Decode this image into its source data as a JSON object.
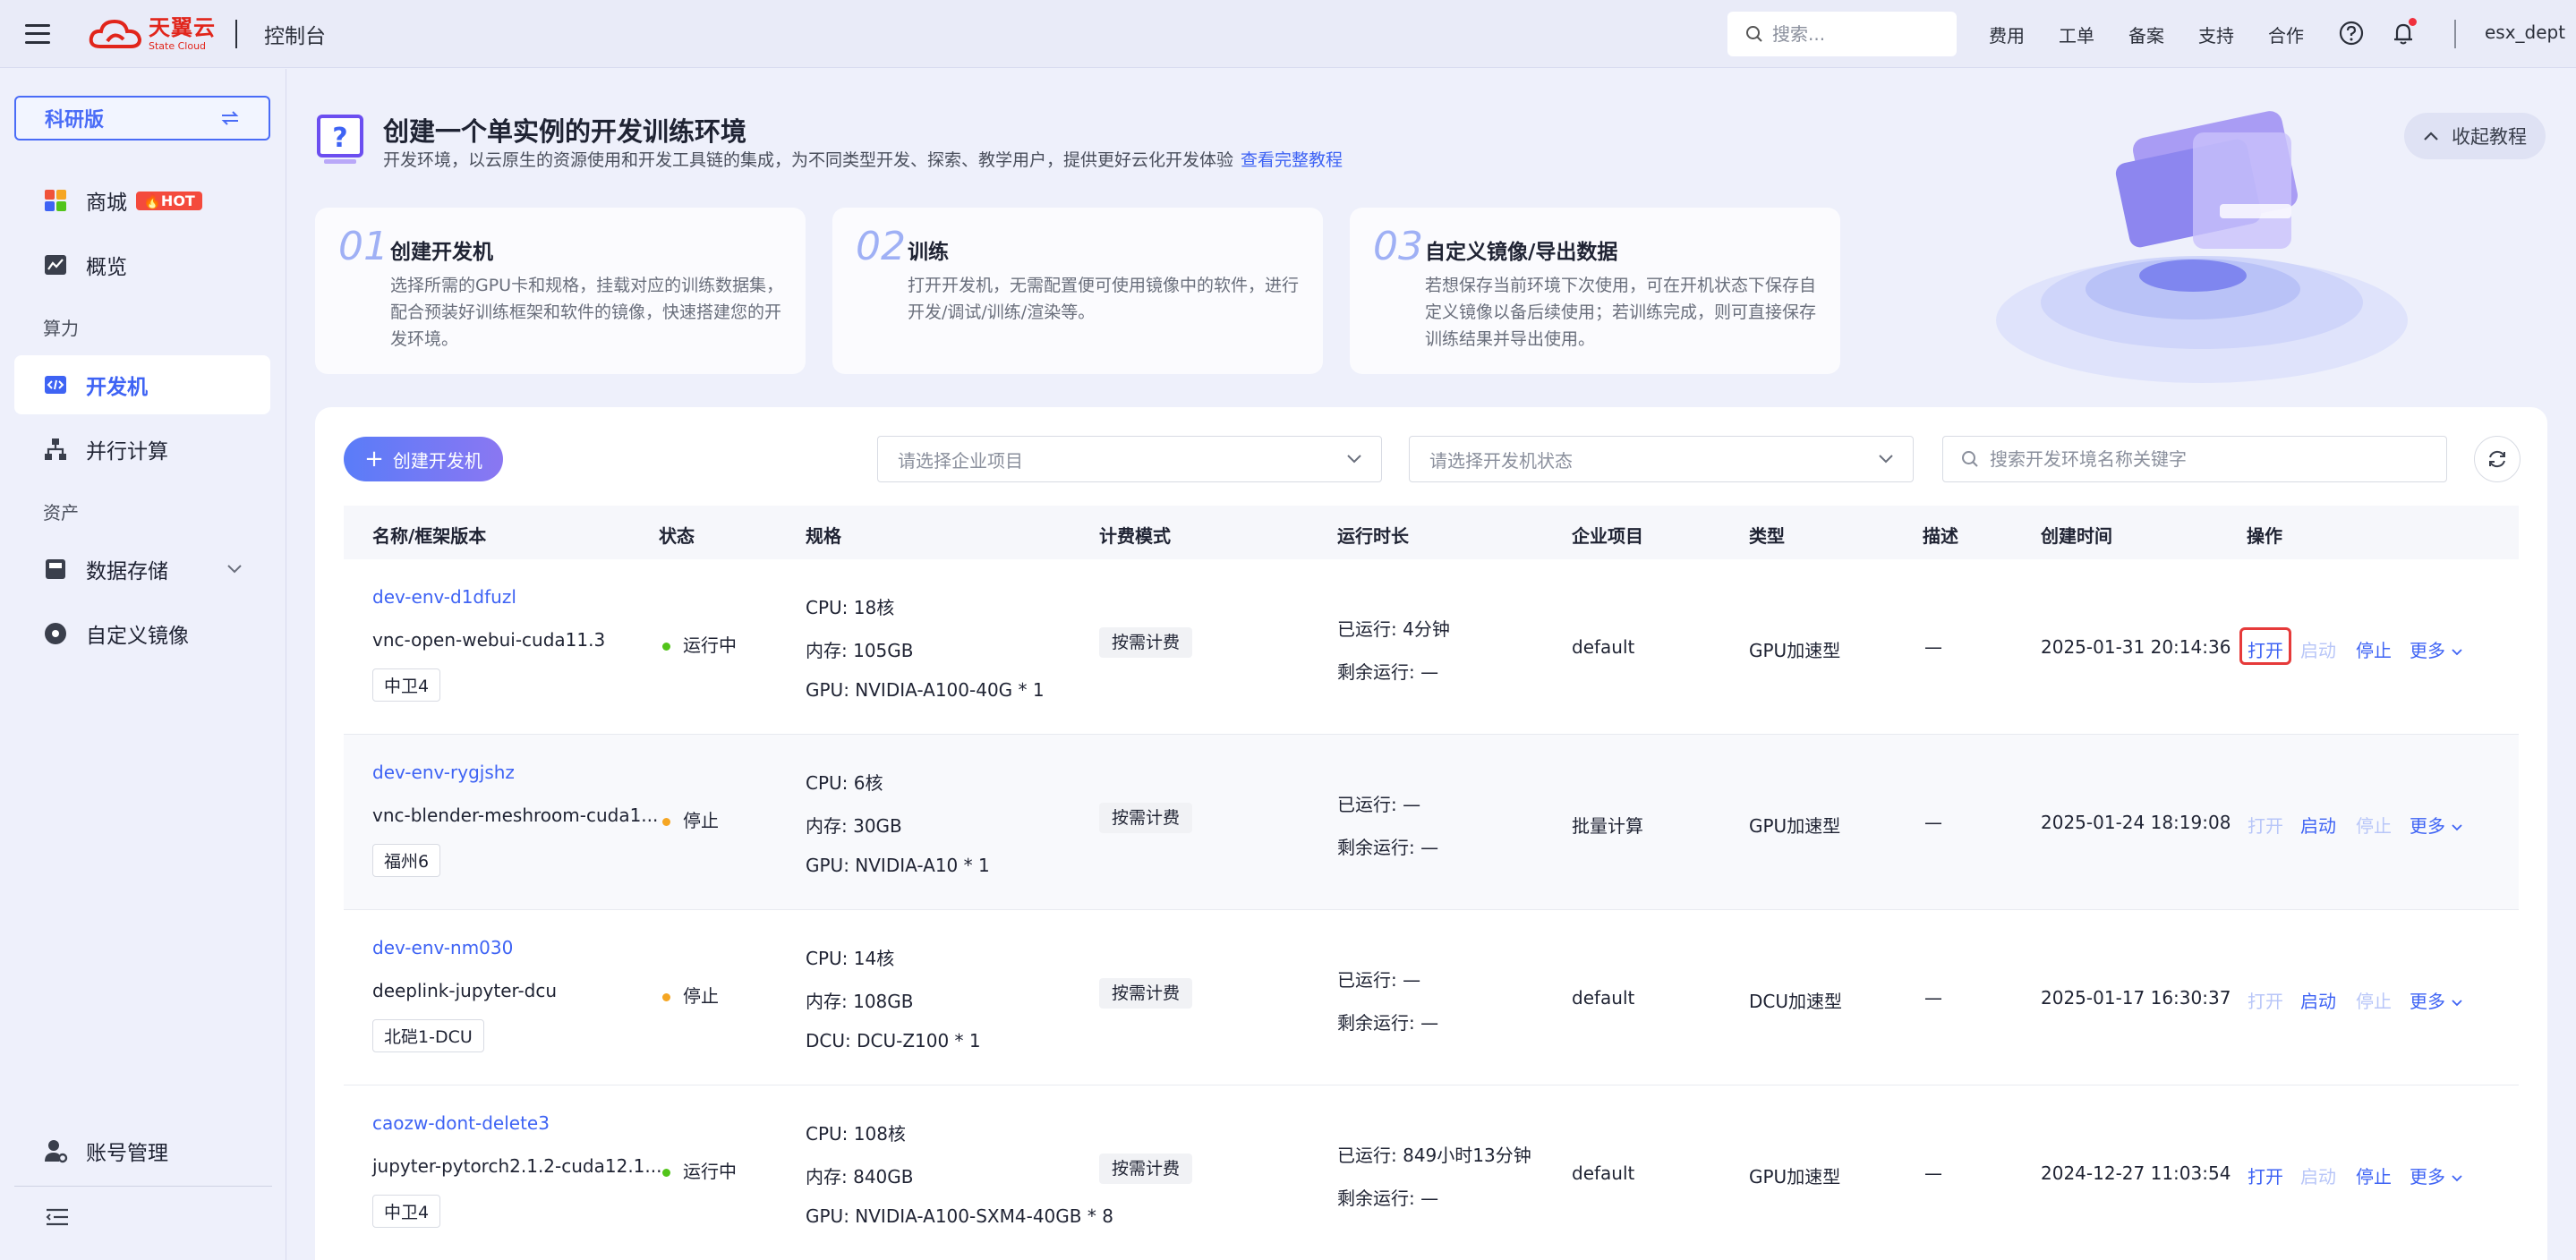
{
  "header": {
    "logo_cn": "天翼云",
    "logo_en": "State Cloud",
    "console_title": "控制台",
    "search_placeholder": "搜索...",
    "links": [
      "费用",
      "工单",
      "备案",
      "支持",
      "合作"
    ],
    "username": "esx_dept"
  },
  "sidebar": {
    "edition": "科研版",
    "items": [
      {
        "label": "商城",
        "badge": "HOT",
        "icon": "mall-icon"
      },
      {
        "label": "概览",
        "icon": "overview-chart-icon"
      }
    ],
    "group_compute": "算力",
    "compute_items": [
      {
        "label": "开发机",
        "icon": "code-window-icon",
        "active": true
      },
      {
        "label": "并行计算",
        "icon": "hierarchy-icon"
      }
    ],
    "group_assets": "资产",
    "asset_items": [
      {
        "label": "数据存储",
        "icon": "storage-icon"
      },
      {
        "label": "自定义镜像",
        "icon": "disc-icon"
      }
    ],
    "account": "账号管理"
  },
  "hero": {
    "title": "创建一个单实例的开发训练环境",
    "subtitle": "开发环境，以云原生的资源使用和开发工具链的集成，为不同类型开发、探索、教学用户，提供更好云化开发体验",
    "tutorial_link": "查看完整教程",
    "collapse_label": "收起教程",
    "steps": [
      {
        "num": "01",
        "title": "创建开发机",
        "desc": "选择所需的GPU卡和规格，挂载对应的训练数据集，配合预装好训练框架和软件的镜像，快速搭建您的开发环境。"
      },
      {
        "num": "02",
        "title": "训练",
        "desc": "打开开发机，无需配置便可使用镜像中的软件，进行开发/调试/训练/渲染等。"
      },
      {
        "num": "03",
        "title": "自定义镜像/导出数据",
        "desc": "若想保存当前环境下次使用，可在开机状态下保存自定义镜像以备后续使用；若训练完成，则可直接保存训练结果并导出使用。"
      }
    ]
  },
  "toolbar": {
    "create_label": "创建开发机",
    "project_placeholder": "请选择企业项目",
    "status_placeholder": "请选择开发机状态",
    "search_placeholder": "搜索开发环境名称关键字"
  },
  "table": {
    "columns": [
      "名称/框架版本",
      "状态",
      "规格",
      "计费模式",
      "运行时长",
      "企业项目",
      "类型",
      "描述",
      "创建时间",
      "操作"
    ],
    "ops": {
      "open": "打开",
      "start": "启动",
      "stop": "停止",
      "more": "更多"
    },
    "rows": [
      {
        "name": "dev-env-d1dfuzl",
        "image": "vnc-open-webui-cuda11.3",
        "region": "中卫4",
        "status": "运行中",
        "status_color": "#52c41a",
        "cpu": "CPU: 18核",
        "mem": "内存: 105GB",
        "gpu": "GPU: NVIDIA-A100-40G * 1",
        "billing": "按需计费",
        "ran": "已运行: 4分钟",
        "remain": "剩余运行: —",
        "project": "default",
        "type": "GPU加速型",
        "desc": "—",
        "created": "2025-01-31 20:14:36",
        "open_on": true,
        "start_on": false,
        "stop_on": true
      },
      {
        "name": "dev-env-rygjshz",
        "image": "vnc-blender-meshroom-cuda1...",
        "region": "福州6",
        "status": "停止",
        "status_color": "#f5a623",
        "cpu": "CPU: 6核",
        "mem": "内存: 30GB",
        "gpu": "GPU: NVIDIA-A10 * 1",
        "billing": "按需计费",
        "ran": "已运行: —",
        "remain": "剩余运行: —",
        "project": "批量计算",
        "type": "GPU加速型",
        "desc": "—",
        "created": "2025-01-24 18:19:08",
        "open_on": false,
        "start_on": true,
        "stop_on": false
      },
      {
        "name": "dev-env-nm030",
        "image": "deeplink-jupyter-dcu",
        "region": "北硙1-DCU",
        "status": "停止",
        "status_color": "#f5a623",
        "cpu": "CPU: 14核",
        "mem": "内存: 108GB",
        "gpu": "DCU: DCU-Z100 * 1",
        "billing": "按需计费",
        "ran": "已运行: —",
        "remain": "剩余运行: —",
        "project": "default",
        "type": "DCU加速型",
        "desc": "—",
        "created": "2025-01-17 16:30:37",
        "open_on": false,
        "start_on": true,
        "stop_on": false
      },
      {
        "name": "caozw-dont-delete3",
        "image": "jupyter-pytorch2.1.2-cuda12.1...",
        "region": "中卫4",
        "status": "运行中",
        "status_color": "#52c41a",
        "cpu": "CPU: 108核",
        "mem": "内存: 840GB",
        "gpu": "GPU: NVIDIA-A100-SXM4-40GB * 8",
        "billing": "按需计费",
        "ran": "已运行: 849小时13分钟",
        "remain": "剩余运行: —",
        "project": "default",
        "type": "GPU加速型",
        "desc": "—",
        "created": "2024-12-27 11:03:54",
        "open_on": true,
        "start_on": false,
        "stop_on": true
      }
    ]
  },
  "colors": {
    "accent": "#3e63f4",
    "brand": "#e1251b",
    "running": "#52c41a",
    "stopped": "#f5a623",
    "highlight": "#e63a3a"
  }
}
